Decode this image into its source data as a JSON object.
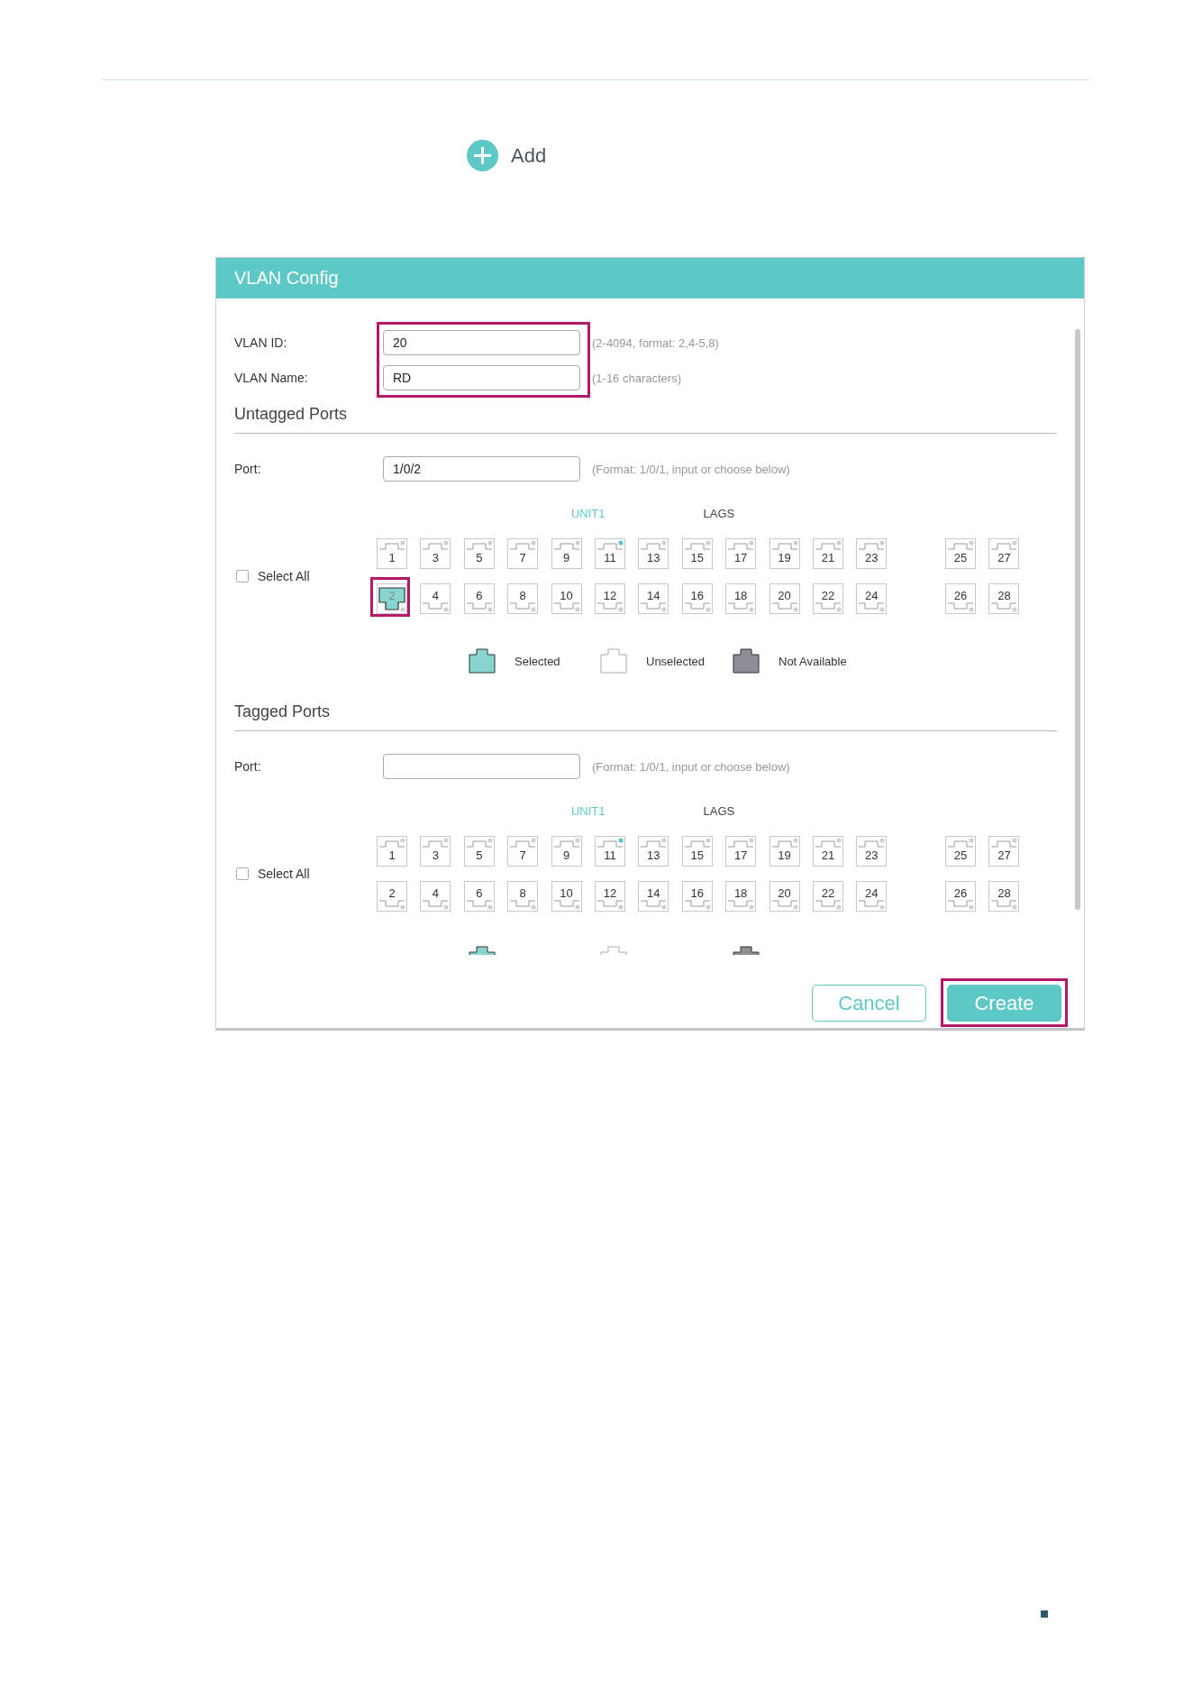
{
  "add_button": {
    "label": "Add"
  },
  "dialog": {
    "title": "VLAN Config",
    "fields": [
      {
        "label": "VLAN ID:",
        "value": "20",
        "hint": "(2-4094, format: 2,4-5,8)"
      },
      {
        "label": "VLAN Name:",
        "value": "RD",
        "hint": "(1-16 characters)"
      }
    ],
    "fields_highlighted": true,
    "sections": [
      {
        "heading": "Untagged Ports",
        "port_label": "Port:",
        "port_value": "1/0/2",
        "hint": "(Format: 1/0/1, input or choose below)",
        "group_labels": [
          {
            "text": "UNIT1",
            "active": true
          },
          {
            "text": "LAGS",
            "active": false
          }
        ],
        "select_all": {
          "label": "Select All",
          "checked": false
        },
        "ports": [
          {
            "number": "1",
            "selected": false,
            "link_up": false,
            "highlighted": false
          },
          {
            "number": "2",
            "selected": true,
            "link_up": false,
            "highlighted": true
          },
          {
            "number": "3",
            "selected": false,
            "link_up": false,
            "highlighted": false
          },
          {
            "number": "4",
            "selected": false,
            "link_up": false,
            "highlighted": false
          },
          {
            "number": "5",
            "selected": false,
            "link_up": false,
            "highlighted": false
          },
          {
            "number": "6",
            "selected": false,
            "link_up": false,
            "highlighted": false
          },
          {
            "number": "7",
            "selected": false,
            "link_up": false,
            "highlighted": false
          },
          {
            "number": "8",
            "selected": false,
            "link_up": false,
            "highlighted": false
          },
          {
            "number": "9",
            "selected": false,
            "link_up": false,
            "highlighted": false
          },
          {
            "number": "10",
            "selected": false,
            "link_up": false,
            "highlighted": false
          },
          {
            "number": "11",
            "selected": false,
            "link_up": true,
            "highlighted": false
          },
          {
            "number": "12",
            "selected": false,
            "link_up": false,
            "highlighted": false
          },
          {
            "number": "13",
            "selected": false,
            "link_up": false,
            "highlighted": false
          },
          {
            "number": "14",
            "selected": false,
            "link_up": false,
            "highlighted": false
          },
          {
            "number": "15",
            "selected": false,
            "link_up": false,
            "highlighted": false
          },
          {
            "number": "16",
            "selected": false,
            "link_up": false,
            "highlighted": false
          },
          {
            "number": "17",
            "selected": false,
            "link_up": false,
            "highlighted": false
          },
          {
            "number": "18",
            "selected": false,
            "link_up": false,
            "highlighted": false
          },
          {
            "number": "19",
            "selected": false,
            "link_up": false,
            "highlighted": false
          },
          {
            "number": "20",
            "selected": false,
            "link_up": false,
            "highlighted": false
          },
          {
            "number": "21",
            "selected": false,
            "link_up": false,
            "highlighted": false
          },
          {
            "number": "22",
            "selected": false,
            "link_up": false,
            "highlighted": false
          },
          {
            "number": "23",
            "selected": false,
            "link_up": false,
            "highlighted": false
          },
          {
            "number": "24",
            "selected": false,
            "link_up": false,
            "highlighted": false
          },
          {
            "number": "25",
            "selected": false,
            "link_up": false,
            "highlighted": false
          },
          {
            "number": "26",
            "selected": false,
            "link_up": false,
            "highlighted": false
          },
          {
            "number": "27",
            "selected": false,
            "link_up": false,
            "highlighted": false
          },
          {
            "number": "28",
            "selected": false,
            "link_up": false,
            "highlighted": false
          }
        ],
        "legend": [
          {
            "kind": "selected",
            "label": "Selected"
          },
          {
            "kind": "unselected",
            "label": "Unselected"
          },
          {
            "kind": "not_available",
            "label": "Not Available"
          }
        ]
      },
      {
        "heading": "Tagged Ports",
        "port_label": "Port:",
        "hint": "(Format: 1/0/1, input or choose below)",
        "group_labels": [
          {
            "text": "UNIT1",
            "active": true
          },
          {
            "text": "LAGS",
            "active": false
          }
        ],
        "select_all": {
          "label": "Select All",
          "checked": false
        },
        "ports": [
          {
            "number": "1",
            "selected": false,
            "link_up": false,
            "highlighted": false
          },
          {
            "number": "2",
            "selected": false,
            "link_up": false,
            "highlighted": false
          },
          {
            "number": "3",
            "selected": false,
            "link_up": false,
            "highlighted": false
          },
          {
            "number": "4",
            "selected": false,
            "link_up": false,
            "highlighted": false
          },
          {
            "number": "5",
            "selected": false,
            "link_up": false,
            "highlighted": false
          },
          {
            "number": "6",
            "selected": false,
            "link_up": false,
            "highlighted": false
          },
          {
            "number": "7",
            "selected": false,
            "link_up": false,
            "highlighted": false
          },
          {
            "number": "8",
            "selected": false,
            "link_up": false,
            "highlighted": false
          },
          {
            "number": "9",
            "selected": false,
            "link_up": false,
            "highlighted": false
          },
          {
            "number": "10",
            "selected": false,
            "link_up": false,
            "highlighted": false
          },
          {
            "number": "11",
            "selected": false,
            "link_up": true,
            "highlighted": false
          },
          {
            "number": "12",
            "selected": false,
            "link_up": false,
            "highlighted": false
          },
          {
            "number": "13",
            "selected": false,
            "link_up": false,
            "highlighted": false
          },
          {
            "number": "14",
            "selected": false,
            "link_up": false,
            "highlighted": false
          },
          {
            "number": "15",
            "selected": false,
            "link_up": false,
            "highlighted": false
          },
          {
            "number": "16",
            "selected": false,
            "link_up": false,
            "highlighted": false
          },
          {
            "number": "17",
            "selected": false,
            "link_up": false,
            "highlighted": false
          },
          {
            "number": "18",
            "selected": false,
            "link_up": false,
            "highlighted": false
          },
          {
            "number": "19",
            "selected": false,
            "link_up": false,
            "highlighted": false
          },
          {
            "number": "20",
            "selected": false,
            "link_up": false,
            "highlighted": false
          },
          {
            "number": "21",
            "selected": false,
            "link_up": false,
            "highlighted": false
          },
          {
            "number": "22",
            "selected": false,
            "link_up": false,
            "highlighted": false
          },
          {
            "number": "23",
            "selected": false,
            "link_up": false,
            "highlighted": false
          },
          {
            "number": "24",
            "selected": false,
            "link_up": false,
            "highlighted": false
          },
          {
            "number": "25",
            "selected": false,
            "link_up": false,
            "highlighted": false
          },
          {
            "number": "26",
            "selected": false,
            "link_up": false,
            "highlighted": false
          },
          {
            "number": "27",
            "selected": false,
            "link_up": false,
            "highlighted": false
          },
          {
            "number": "28",
            "selected": false,
            "link_up": false,
            "highlighted": false
          }
        ],
        "legend": [
          {
            "kind": "selected"
          },
          {
            "kind": "unselected"
          },
          {
            "kind": "not_available"
          }
        ]
      }
    ],
    "buttons": [
      {
        "label": "Cancel",
        "kind": "secondary",
        "highlighted": false
      },
      {
        "label": "Create",
        "kind": "primary",
        "highlighted": true
      }
    ]
  }
}
